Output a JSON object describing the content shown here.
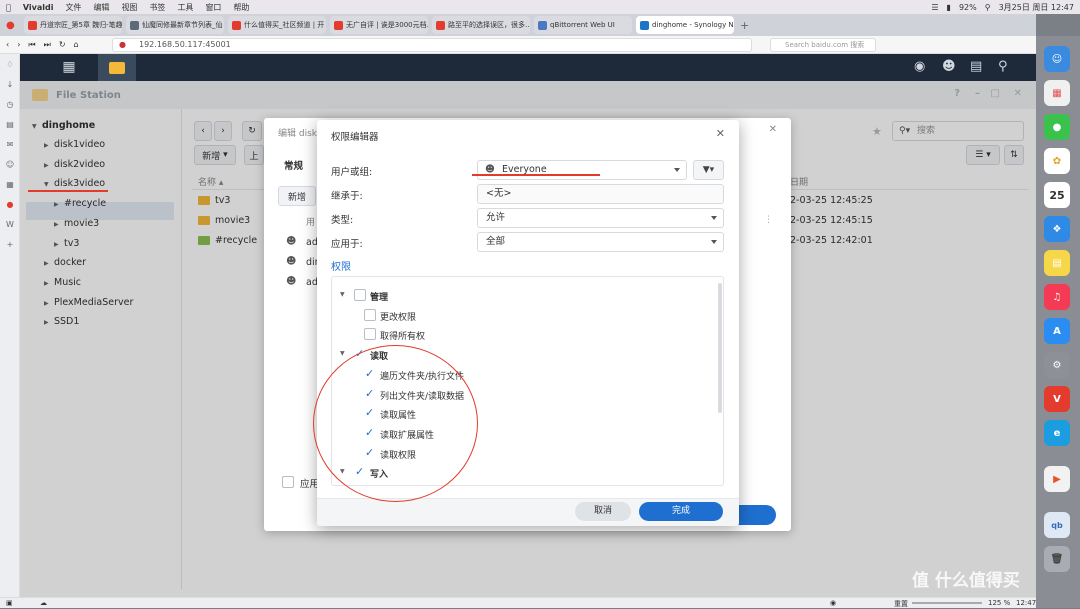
{
  "mac_menubar": {
    "app": "Vivaldi",
    "menus": [
      "文件",
      "编辑",
      "视图",
      "书签",
      "工具",
      "窗口",
      "帮助"
    ],
    "battery": "92%",
    "clock": "3月25日 周日 12:47"
  },
  "tabs": [
    {
      "label": "丹道宗匠_第5章 魏归-笔趣",
      "color": "#e33b2e"
    },
    {
      "label": "仙魔同修最新章节列表_仙",
      "color": "#5a6b7a"
    },
    {
      "label": "什么值得买_社区频道 | 开",
      "color": "#e33b2e"
    },
    {
      "label": "无广自评 | 诶是3000元档…",
      "color": "#e33b2e"
    },
    {
      "label": "路至平的选择误区，很多…",
      "color": "#e33b2e"
    },
    {
      "label": "qBittorrent Web UI",
      "color": "#4a78c2"
    },
    {
      "label": "dinghome - Synology NAS",
      "color": "#1b74c6",
      "active": true
    }
  ],
  "address": {
    "url": "192.168.50.117:45001",
    "search_placeholder": "Search baidu.com 搜索"
  },
  "file_station": {
    "title": "File Station",
    "tree": {
      "root": "dinghome",
      "items": [
        {
          "label": "disk1video",
          "level": 1,
          "expanded": false
        },
        {
          "label": "disk2video",
          "level": 1,
          "expanded": false
        },
        {
          "label": "disk3video",
          "level": 1,
          "expanded": true,
          "selected": true
        },
        {
          "label": "#recycle",
          "level": 2,
          "expanded": false
        },
        {
          "label": "movie3",
          "level": 2,
          "expanded": false
        },
        {
          "label": "tv3",
          "level": 2,
          "expanded": false
        },
        {
          "label": "docker",
          "level": 1,
          "expanded": false
        },
        {
          "label": "Music",
          "level": 1,
          "expanded": false
        },
        {
          "label": "PlexMediaServer",
          "level": 1,
          "expanded": false
        },
        {
          "label": "SSD1",
          "level": 1,
          "expanded": false
        }
      ]
    },
    "toolbar": {
      "new": "新增",
      "upload": "上",
      "search_placeholder": "搜索"
    },
    "columns": {
      "name": "名称",
      "date": "日期"
    },
    "files": [
      {
        "name": "tv3",
        "date": "2-03-25 12:45:25"
      },
      {
        "name": "movie3",
        "date": "2-03-25 12:45:15"
      },
      {
        "name": "#recycle",
        "date": "2-03-25 12:42:01"
      }
    ]
  },
  "edit_dialog": {
    "title": "编辑 disk",
    "tab_general": "常规",
    "new_button": "新增",
    "user_col": "用",
    "users": [
      "ad",
      "din",
      "ad"
    ],
    "apply_label": "应用"
  },
  "perm_dialog": {
    "title": "权限编辑器",
    "user_label": "用户或组:",
    "user_value": "Everyone",
    "inherit_label": "继承于:",
    "inherit_value": "<无>",
    "type_label": "类型:",
    "type_value": "允许",
    "apply_label": "应用于:",
    "apply_value": "全部",
    "perm_heading": "权限",
    "perms": [
      {
        "label": "管理",
        "level": 0,
        "checked": false,
        "group": true
      },
      {
        "label": "更改权限",
        "level": 1,
        "checked": false
      },
      {
        "label": "取得所有权",
        "level": 1,
        "checked": false
      },
      {
        "label": "读取",
        "level": 0,
        "checked": true,
        "group": true
      },
      {
        "label": "遍历文件夹/执行文件",
        "level": 1,
        "checked": true
      },
      {
        "label": "列出文件夹/读取数据",
        "level": 1,
        "checked": true
      },
      {
        "label": "读取属性",
        "level": 1,
        "checked": true
      },
      {
        "label": "读取扩展属性",
        "level": 1,
        "checked": true
      },
      {
        "label": "读取权限",
        "level": 1,
        "checked": true
      },
      {
        "label": "写入",
        "level": 0,
        "checked": true,
        "group": true
      }
    ],
    "cancel": "取消",
    "done": "完成"
  },
  "statusbar": {
    "zoom": "125 %",
    "time": "12:47",
    "reset": "重置"
  },
  "watermark": "值 什么值得买",
  "colors": {
    "accent": "#1f6fd0",
    "annotation": "#e03b2b",
    "dsm_bar": "#1e2a3a"
  }
}
